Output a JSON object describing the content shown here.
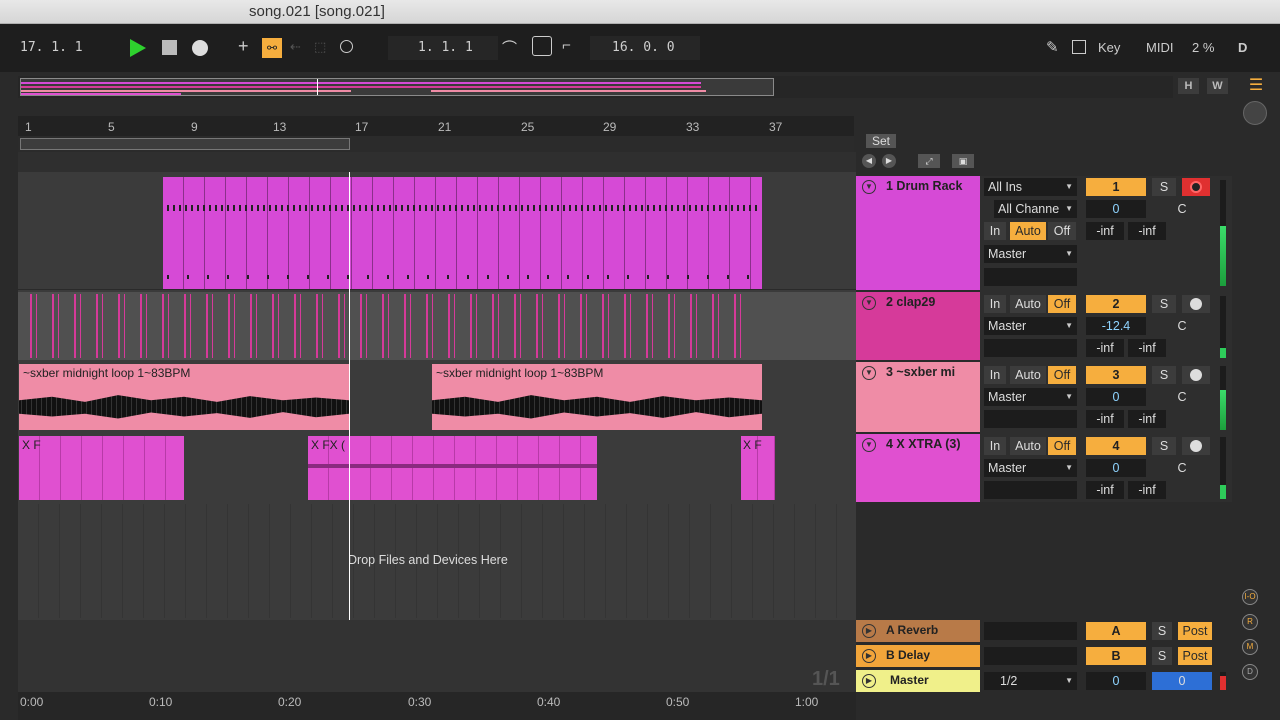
{
  "window": {
    "title": "song.021  [song.021]"
  },
  "transport": {
    "position": "17.   1.   1",
    "loop_start": "1.   1.   1",
    "loop_length": "16.   0.   0",
    "key_label": "Key",
    "midi_label": "MIDI",
    "cpu": "2 %",
    "disk": "D"
  },
  "overview": {
    "h_label": "H",
    "w_label": "W"
  },
  "ruler": {
    "bars": [
      "1",
      "5",
      "9",
      "13",
      "17",
      "21",
      "25",
      "29",
      "33",
      "37"
    ]
  },
  "set_label": "Set",
  "tracks": [
    {
      "name": "1 Drum Rack",
      "color": "#d64ad6",
      "input_type": "All Ins",
      "input_channel": "All Channe",
      "monitor": [
        "In",
        "Auto",
        "Off"
      ],
      "output": "Master",
      "number": "1",
      "volume": "0",
      "pan": "C",
      "peak_l": "-inf",
      "peak_r": "-inf",
      "solo": "S"
    },
    {
      "name": "2 clap29",
      "color": "#d63a9a",
      "monitor": [
        "In",
        "Auto",
        "Off"
      ],
      "output": "Master",
      "number": "2",
      "volume": "-12.4",
      "pan": "C",
      "peak_l": "-inf",
      "peak_r": "-inf",
      "solo": "S"
    },
    {
      "name": "3 ~sxber mi",
      "color": "#ef8ca6",
      "monitor": [
        "In",
        "Auto",
        "Off"
      ],
      "output": "Master",
      "number": "3",
      "volume": "0",
      "pan": "C",
      "peak_l": "-inf",
      "peak_r": "-inf",
      "solo": "S"
    },
    {
      "name": "4 X XTRA (3)",
      "color": "#e050d0",
      "monitor": [
        "In",
        "Auto",
        "Off"
      ],
      "output": "Master",
      "number": "4",
      "volume": "0",
      "pan": "C",
      "peak_l": "-inf",
      "peak_r": "-inf",
      "solo": "S"
    }
  ],
  "clips": {
    "loop_clip_name": "~sxber midnight loop 1~83BPM",
    "xtra_clip_name": "X F",
    "xtra_fx_name": "X FX ("
  },
  "drop_hint": "Drop Files and Devices Here",
  "returns": [
    {
      "name": "A Reverb",
      "color": "#b87a48",
      "letter": "A",
      "solo": "S",
      "post": "Post"
    },
    {
      "name": "B Delay",
      "color": "#f2a53a",
      "letter": "B",
      "solo": "S",
      "post": "Post"
    }
  ],
  "master": {
    "name": "Master",
    "color": "#f0f08a",
    "output": "1/2",
    "volume": "0",
    "pan": "0"
  },
  "page_indicator": "1/1",
  "timeline": [
    "0:00",
    "0:10",
    "0:20",
    "0:30",
    "0:40",
    "0:50",
    "1:00"
  ],
  "side_icons": [
    "I-O",
    "R",
    "M",
    "D"
  ]
}
